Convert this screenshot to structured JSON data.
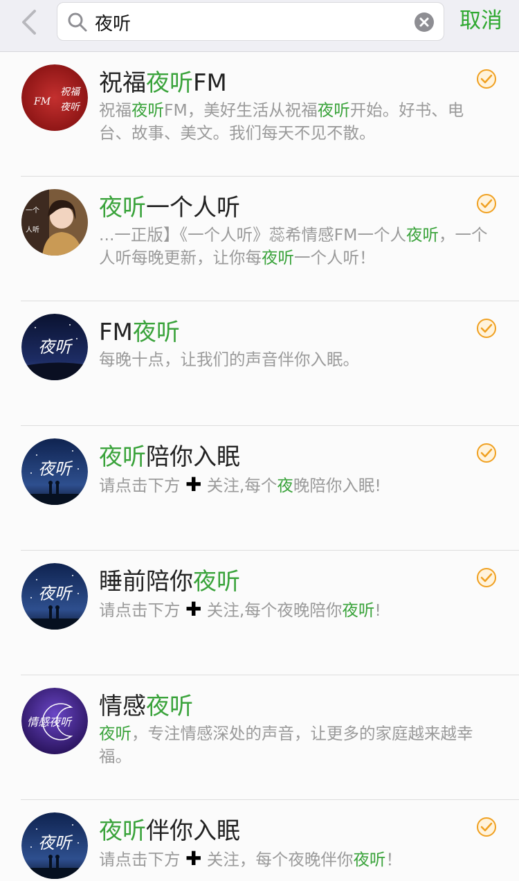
{
  "search": {
    "query": "夜听",
    "cancel_label": "取消"
  },
  "icons": {
    "back": "chevron-left-icon",
    "search": "search-icon",
    "clear": "clear-icon",
    "selected": "check-circle-icon"
  },
  "colors": {
    "highlight": "#3aa33b",
    "cancel": "#2fa830",
    "check": "#f0a020"
  },
  "results": [
    {
      "title": [
        [
          "祝福",
          0
        ],
        [
          "夜听",
          1
        ],
        [
          "FM",
          0
        ]
      ],
      "desc": [
        [
          "祝福",
          0
        ],
        [
          "夜听",
          1
        ],
        [
          "FM，美好生活从祝福",
          0
        ],
        [
          "夜听",
          1
        ],
        [
          "开始。好书、电台、故事、美文。我们每天不见不散。",
          0
        ]
      ],
      "avatar": "red-calligraphy-avatar",
      "avatar_text": [
        "祝福",
        "夜听",
        "FM"
      ]
    },
    {
      "title": [
        [
          "夜听",
          1
        ],
        [
          "一个人听",
          0
        ]
      ],
      "desc": [
        [
          "...一正版】《一个人听》蕊希情感FM一个人",
          0
        ],
        [
          "夜",
          1
        ],
        [
          "听",
          1
        ],
        [
          "，一个人听每晚更新，让你每",
          0
        ],
        [
          "夜听",
          1
        ],
        [
          "一个人听！",
          0
        ]
      ],
      "avatar": "woman-photo-avatar",
      "avatar_text": [
        "一个人听"
      ]
    },
    {
      "title": [
        [
          "FM",
          0
        ],
        [
          "夜听",
          1
        ]
      ],
      "desc": [
        [
          "每晚十点，让我们的声音伴你入眠。",
          0
        ]
      ],
      "avatar": "night-sky-avatar",
      "avatar_text": [
        "夜听"
      ]
    },
    {
      "title": [
        [
          "夜听",
          1
        ],
        [
          "陪你入眠",
          0
        ]
      ],
      "desc": [
        [
          "请点击下方 ",
          0
        ],
        [
          "✚",
          2
        ],
        [
          " 关注,每个",
          0
        ],
        [
          "夜",
          1
        ],
        [
          "晚陪你入眠!",
          0
        ]
      ],
      "avatar": "starry-couple-avatar",
      "avatar_text": [
        "夜听"
      ]
    },
    {
      "title": [
        [
          "睡前陪你",
          0
        ],
        [
          "夜听",
          1
        ]
      ],
      "desc": [
        [
          "请点击下方 ",
          0
        ],
        [
          "✚",
          2
        ],
        [
          " 关注,每个夜晚陪你",
          0
        ],
        [
          "夜听",
          1
        ],
        [
          "!",
          0
        ]
      ],
      "avatar": "starry-couple-avatar",
      "avatar_text": [
        "夜听"
      ]
    },
    {
      "title": [
        [
          "情感",
          0
        ],
        [
          "夜听",
          1
        ]
      ],
      "desc": [
        [
          "夜听",
          1
        ],
        [
          "，专注情感深处的声音，让更多的家庭越来越幸福。",
          0
        ]
      ],
      "avatar": "purple-moon-avatar",
      "avatar_text": [
        "情感夜听"
      ],
      "checked": false
    },
    {
      "title": [
        [
          "夜听",
          1
        ],
        [
          "伴你入眠",
          0
        ]
      ],
      "desc": [
        [
          "请点击下方 ",
          0
        ],
        [
          "✚",
          2
        ],
        [
          " 关注，每个夜晚伴你",
          0
        ],
        [
          "夜听",
          1
        ],
        [
          "！",
          0
        ]
      ],
      "avatar": "starry-couple-avatar",
      "avatar_text": [
        "夜听"
      ]
    }
  ]
}
